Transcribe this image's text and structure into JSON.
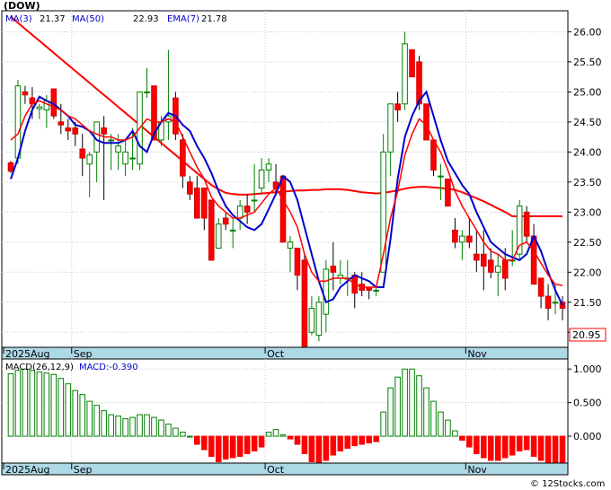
{
  "chart_data": [
    {
      "type": "candlestick",
      "title": "(DOW)",
      "legend": [
        {
          "label": "MA(3)",
          "value": "21.37",
          "color": "#0000cc"
        },
        {
          "label": "MA(50)",
          "value": "22.93",
          "color": "#ff0000"
        },
        {
          "label": "EMA(7)",
          "value": "21.78",
          "color": "#000000"
        }
      ],
      "last_price": "20.95",
      "ylim": [
        20.75,
        26.35
      ],
      "y_ticks": [
        "26.00",
        "25.50",
        "25.00",
        "24.50",
        "24.00",
        "23.50",
        "23.00",
        "22.50",
        "22.00",
        "21.50",
        "21.00"
      ],
      "x_ticks": [
        {
          "label": "2025Aug",
          "i": 0
        },
        {
          "label": "Sep",
          "i": 9
        },
        {
          "label": "Oct",
          "i": 36
        },
        {
          "label": "Nov",
          "i": 64
        }
      ],
      "candles": [
        [
          23.82,
          23.85,
          23.65,
          23.68
        ],
        [
          23.9,
          25.2,
          23.8,
          25.1
        ],
        [
          25.0,
          25.1,
          24.8,
          24.95
        ],
        [
          24.9,
          25.08,
          24.55,
          24.8
        ],
        [
          24.72,
          24.8,
          24.55,
          24.75
        ],
        [
          24.7,
          24.95,
          24.4,
          24.85
        ],
        [
          25.05,
          25.05,
          24.55,
          24.6
        ],
        [
          24.5,
          24.8,
          24.3,
          24.45
        ],
        [
          24.4,
          24.55,
          24.2,
          24.35
        ],
        [
          24.4,
          24.5,
          24.1,
          24.3
        ],
        [
          24.05,
          24.3,
          23.6,
          23.9
        ],
        [
          23.8,
          24.0,
          23.25,
          23.95
        ],
        [
          24.0,
          24.5,
          23.5,
          24.5
        ],
        [
          24.4,
          24.6,
          23.2,
          24.3
        ],
        [
          24.2,
          24.3,
          23.7,
          24.2
        ],
        [
          24.0,
          24.3,
          23.7,
          24.1
        ],
        [
          23.8,
          24.2,
          23.6,
          24.0
        ],
        [
          23.9,
          24.4,
          23.7,
          23.9
        ],
        [
          23.8,
          25.0,
          23.7,
          25.0
        ],
        [
          25.0,
          25.4,
          24.9,
          25.0
        ],
        [
          25.1,
          25.1,
          24.3,
          24.2
        ],
        [
          24.2,
          24.6,
          24.1,
          24.5
        ],
        [
          24.5,
          25.7,
          24.2,
          24.6
        ],
        [
          24.9,
          25.0,
          24.2,
          24.3
        ],
        [
          24.2,
          24.3,
          23.4,
          23.6
        ],
        [
          23.5,
          23.6,
          23.2,
          23.3
        ],
        [
          23.4,
          23.6,
          22.9,
          22.9
        ],
        [
          23.4,
          23.4,
          22.7,
          22.9
        ],
        [
          23.2,
          23.2,
          22.3,
          22.2
        ],
        [
          22.4,
          22.9,
          22.4,
          22.8
        ],
        [
          22.9,
          23.0,
          22.7,
          22.8
        ],
        [
          22.7,
          22.9,
          22.4,
          22.7
        ],
        [
          22.9,
          23.2,
          22.7,
          23.1
        ],
        [
          23.1,
          23.3,
          22.8,
          23.0
        ],
        [
          23.2,
          23.8,
          23.0,
          23.2
        ],
        [
          23.4,
          23.9,
          23.3,
          23.7
        ],
        [
          23.7,
          23.9,
          23.5,
          23.8
        ],
        [
          23.5,
          23.8,
          23.3,
          23.4
        ],
        [
          23.6,
          23.6,
          22.5,
          22.5
        ],
        [
          22.4,
          22.6,
          22.0,
          22.5
        ],
        [
          22.4,
          22.4,
          21.7,
          21.95
        ],
        [
          22.2,
          22.3,
          20.75,
          20.75
        ],
        [
          21.0,
          21.6,
          20.95,
          21.4
        ],
        [
          20.95,
          21.6,
          20.85,
          21.5
        ],
        [
          21.3,
          22.2,
          21.0,
          22.05
        ],
        [
          22.1,
          22.5,
          21.7,
          22.0
        ],
        [
          21.9,
          22.2,
          21.8,
          21.95
        ],
        [
          21.9,
          22.2,
          21.6,
          21.9
        ],
        [
          21.95,
          22.0,
          21.4,
          21.65
        ],
        [
          21.8,
          22.0,
          21.6,
          21.7
        ],
        [
          21.75,
          21.75,
          21.55,
          21.7
        ],
        [
          21.7,
          21.75,
          21.6,
          21.7
        ],
        [
          22.0,
          24.3,
          22.0,
          24.0
        ],
        [
          24.0,
          24.8,
          23.6,
          24.8
        ],
        [
          24.8,
          25.0,
          24.5,
          24.7
        ],
        [
          24.8,
          26.0,
          24.7,
          25.8
        ],
        [
          25.7,
          25.7,
          25.3,
          25.25
        ],
        [
          25.5,
          25.6,
          24.7,
          24.8
        ],
        [
          24.8,
          24.7,
          24.3,
          24.2
        ],
        [
          24.2,
          24.2,
          23.6,
          23.7
        ],
        [
          23.6,
          23.8,
          23.2,
          23.6
        ],
        [
          23.55,
          23.55,
          23.1,
          23.1
        ],
        [
          22.7,
          22.9,
          22.4,
          22.5
        ],
        [
          22.5,
          22.7,
          22.2,
          22.6
        ],
        [
          22.6,
          22.9,
          22.4,
          22.5
        ],
        [
          22.3,
          22.7,
          22.0,
          22.2
        ],
        [
          22.3,
          22.7,
          21.7,
          22.1
        ],
        [
          22.2,
          22.4,
          21.9,
          22.0
        ],
        [
          22.0,
          22.3,
          21.6,
          22.1
        ],
        [
          22.2,
          22.4,
          21.7,
          21.9
        ],
        [
          22.2,
          22.7,
          22.1,
          22.2
        ],
        [
          22.3,
          23.2,
          22.2,
          23.1
        ],
        [
          23.0,
          23.1,
          22.5,
          22.6
        ],
        [
          22.6,
          22.8,
          21.9,
          21.8
        ],
        [
          21.9,
          21.9,
          21.4,
          21.6
        ],
        [
          21.6,
          21.8,
          21.2,
          21.4
        ],
        [
          21.5,
          21.8,
          21.3,
          21.5
        ],
        [
          21.5,
          21.6,
          21.2,
          21.4
        ]
      ],
      "ma3": [
        23.55,
        23.9,
        24.35,
        24.7,
        24.92,
        24.85,
        24.8,
        24.7,
        24.6,
        24.45,
        24.42,
        24.35,
        24.2,
        24.15,
        24.15,
        24.15,
        24.2,
        24.35,
        24.1,
        24.0,
        24.3,
        24.5,
        24.65,
        24.6,
        24.45,
        24.35,
        24.1,
        23.9,
        23.65,
        23.35,
        23.1,
        22.95,
        22.85,
        22.75,
        22.7,
        22.8,
        23.05,
        23.3,
        23.6,
        23.5,
        23.2,
        22.75,
        22.3,
        21.85,
        21.5,
        21.55,
        21.75,
        21.85,
        21.95,
        21.9,
        21.85,
        21.75,
        21.75,
        22.55,
        23.55,
        24.25,
        24.6,
        24.85,
        25.0,
        24.6,
        24.2,
        23.85,
        23.65,
        23.45,
        23.3,
        23.0,
        22.75,
        22.5,
        22.4,
        22.3,
        22.25,
        22.2,
        22.3,
        22.6,
        22.35,
        22.0,
        21.7,
        21.45
      ],
      "ma50": [
        26.25,
        26.15,
        26.05,
        25.95,
        25.85,
        25.75,
        25.65,
        25.55,
        25.45,
        25.35,
        25.25,
        25.15,
        25.05,
        24.95,
        24.85,
        24.75,
        24.65,
        24.55,
        24.45,
        24.35,
        24.25,
        24.15,
        24.05,
        23.95,
        23.85,
        23.75,
        23.65,
        23.55,
        23.45,
        23.38,
        23.32,
        23.3,
        23.29,
        23.29,
        23.3,
        23.31,
        23.32,
        23.33,
        23.34,
        23.35,
        23.36,
        23.36,
        23.37,
        23.37,
        23.38,
        23.38,
        23.38,
        23.37,
        23.35,
        23.33,
        23.32,
        23.31,
        23.32,
        23.34,
        23.36,
        23.39,
        23.41,
        23.42,
        23.42,
        23.41,
        23.4,
        23.39,
        23.37,
        23.33,
        23.28,
        23.23,
        23.18,
        23.12,
        23.06,
        23.0,
        22.93,
        22.93,
        22.93,
        22.93,
        22.93,
        22.93,
        22.93,
        22.93
      ],
      "ema7": [
        24.2,
        24.3,
        24.6,
        24.8,
        24.85,
        24.8,
        24.75,
        24.7,
        24.6,
        24.55,
        24.45,
        24.35,
        24.3,
        24.25,
        24.25,
        24.2,
        24.2,
        24.25,
        24.4,
        24.55,
        24.5,
        24.5,
        24.55,
        24.5,
        24.25,
        24.0,
        23.75,
        23.55,
        23.25,
        23.1,
        23.0,
        22.9,
        22.9,
        22.95,
        23.0,
        23.15,
        23.3,
        23.4,
        23.2,
        23.0,
        22.75,
        22.3,
        22.0,
        21.85,
        21.85,
        21.9,
        21.9,
        21.9,
        21.8,
        21.75,
        21.75,
        21.75,
        22.3,
        22.9,
        23.35,
        23.95,
        24.3,
        24.55,
        24.45,
        24.2,
        24.0,
        23.7,
        23.35,
        23.1,
        22.9,
        22.7,
        22.5,
        22.35,
        22.3,
        22.2,
        22.2,
        22.45,
        22.5,
        22.35,
        22.15,
        21.95,
        21.8,
        21.78
      ]
    },
    {
      "type": "bar",
      "title": "MACD(26,12,9)",
      "value_label": "MACD:-0.390",
      "ylim": [
        -0.4,
        1.15
      ],
      "y_ticks": [
        "1.000",
        "0.500",
        "0.000"
      ],
      "x_ticks": [
        {
          "label": "2025Aug",
          "i": 0
        },
        {
          "label": "Sep",
          "i": 9
        },
        {
          "label": "Oct",
          "i": 36
        },
        {
          "label": "Nov",
          "i": 64
        }
      ],
      "values": [
        0.93,
        0.98,
        1.0,
        0.98,
        0.96,
        0.94,
        0.92,
        0.86,
        0.78,
        0.68,
        0.62,
        0.52,
        0.46,
        0.38,
        0.32,
        0.3,
        0.26,
        0.28,
        0.32,
        0.32,
        0.28,
        0.24,
        0.18,
        0.12,
        0.06,
        0,
        -0.12,
        -0.2,
        -0.3,
        -0.38,
        -0.34,
        -0.32,
        -0.3,
        -0.26,
        -0.22,
        -0.16,
        0.06,
        0.1,
        0.02,
        -0.04,
        -0.12,
        -0.26,
        -0.38,
        -0.4,
        -0.36,
        -0.28,
        -0.22,
        -0.18,
        -0.14,
        -0.12,
        -0.1,
        -0.08,
        0.36,
        0.72,
        0.88,
        1.0,
        1.0,
        0.9,
        0.72,
        0.52,
        0.36,
        0.24,
        0.08,
        -0.06,
        -0.16,
        -0.26,
        -0.32,
        -0.36,
        -0.36,
        -0.32,
        -0.28,
        -0.22,
        -0.2,
        -0.3,
        -0.36,
        -0.4,
        -0.4,
        -0.39
      ]
    }
  ],
  "watermark": "© 12Stocks.com",
  "colors": {
    "up_fill": "#ffffff",
    "up_stroke": "#008000",
    "down_fill": "#ff0000",
    "down_stroke": "#cc0000",
    "ma3": "#0000cc",
    "ma50": "#ff0000",
    "axis_band": "#add8e6",
    "macd_up": "#008000",
    "macd_down": "#ff0000"
  }
}
